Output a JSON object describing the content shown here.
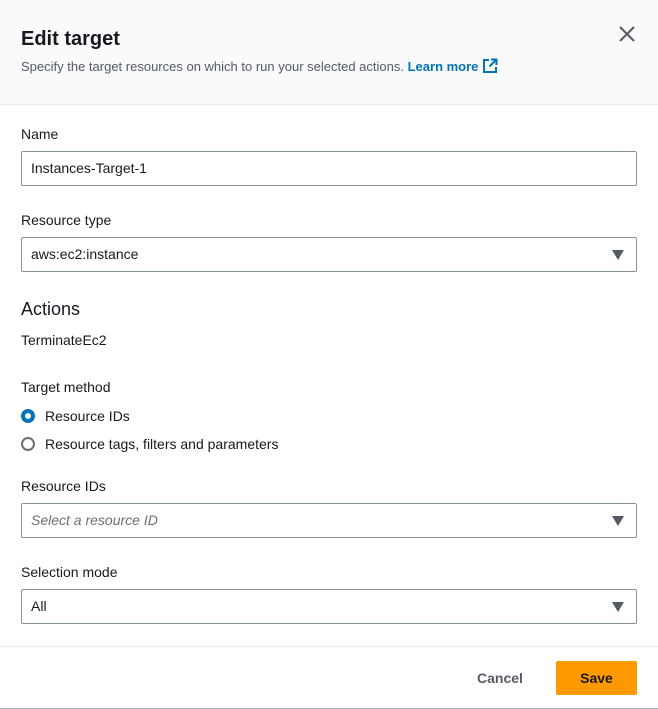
{
  "dialog": {
    "title": "Edit target",
    "subtitle": "Specify the target resources on which to run your selected actions.",
    "learn_more": "Learn more",
    "close_icon": "close-icon"
  },
  "form": {
    "name_label": "Name",
    "name_value": "Instances-Target-1",
    "resource_type_label": "Resource type",
    "resource_type_value": "aws:ec2:instance",
    "actions_title": "Actions",
    "actions_value": "TerminateEc2",
    "target_method_label": "Target method",
    "target_method_options": [
      {
        "label": "Resource IDs",
        "selected": true
      },
      {
        "label": "Resource tags, filters and parameters",
        "selected": false
      }
    ],
    "resource_ids_label": "Resource IDs",
    "resource_ids_placeholder": "Select a resource ID",
    "selection_mode_label": "Selection mode",
    "selection_mode_value": "All"
  },
  "footer": {
    "cancel_label": "Cancel",
    "save_label": "Save"
  },
  "colors": {
    "accent": "#0073bb",
    "primary_button": "#ff9900",
    "border": "#879596"
  }
}
